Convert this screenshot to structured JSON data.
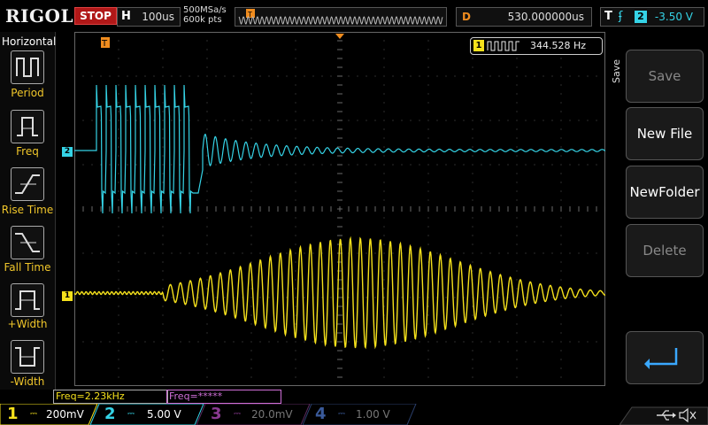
{
  "brand": "RIGOL",
  "run_state": "STOP",
  "timebase": {
    "key": "H",
    "value": "100us"
  },
  "sample": {
    "rate": "500MSa/s",
    "points": "600k pts"
  },
  "delay": {
    "key": "D",
    "value": "530.000000us"
  },
  "trigger": {
    "key": "T",
    "edge": "rising",
    "source": "2",
    "level": "-3.50 V"
  },
  "left_menu": {
    "title": "Horizontal",
    "items": [
      {
        "label": "Period",
        "icon": "period-icon"
      },
      {
        "label": "Freq",
        "icon": "freq-icon"
      },
      {
        "label": "Rise Time",
        "icon": "rise-time-icon"
      },
      {
        "label": "Fall Time",
        "icon": "fall-time-icon"
      },
      {
        "label": "+Width",
        "icon": "pos-width-icon"
      },
      {
        "label": "-Width",
        "icon": "neg-width-icon"
      }
    ]
  },
  "right_menu": {
    "title": "Save",
    "buttons": [
      {
        "label": "Save",
        "enabled": false
      },
      {
        "label": "New File",
        "enabled": true
      },
      {
        "label": "NewFolder",
        "enabled": true
      },
      {
        "label": "Delete",
        "enabled": false
      }
    ],
    "enter_icon": "enter-arrow-icon"
  },
  "measurement": {
    "channel": "1",
    "value": "344.528 Hz",
    "icon": "square-wave-icon"
  },
  "freq_bars": {
    "ch1": "Freq=2.23kHz",
    "ch3": "Freq=*****"
  },
  "channel_markers": {
    "ch1": "1",
    "ch2": "2",
    "trigger": "T"
  },
  "channels": [
    {
      "num": "1",
      "scale": "200mV",
      "color": "#f5e11c",
      "active": true
    },
    {
      "num": "2",
      "scale": "5.00 V",
      "color": "#35d3e6",
      "active": true
    },
    {
      "num": "3",
      "scale": "20.0mV",
      "color": "#c060c8",
      "active": false
    },
    {
      "num": "4",
      "scale": "1.00 V",
      "color": "#4a78d8",
      "active": false
    }
  ],
  "colors": {
    "ch1": "#f5e11c",
    "ch2": "#35d3e6",
    "trigger": "#f08c1e",
    "stop": "#b01818"
  }
}
